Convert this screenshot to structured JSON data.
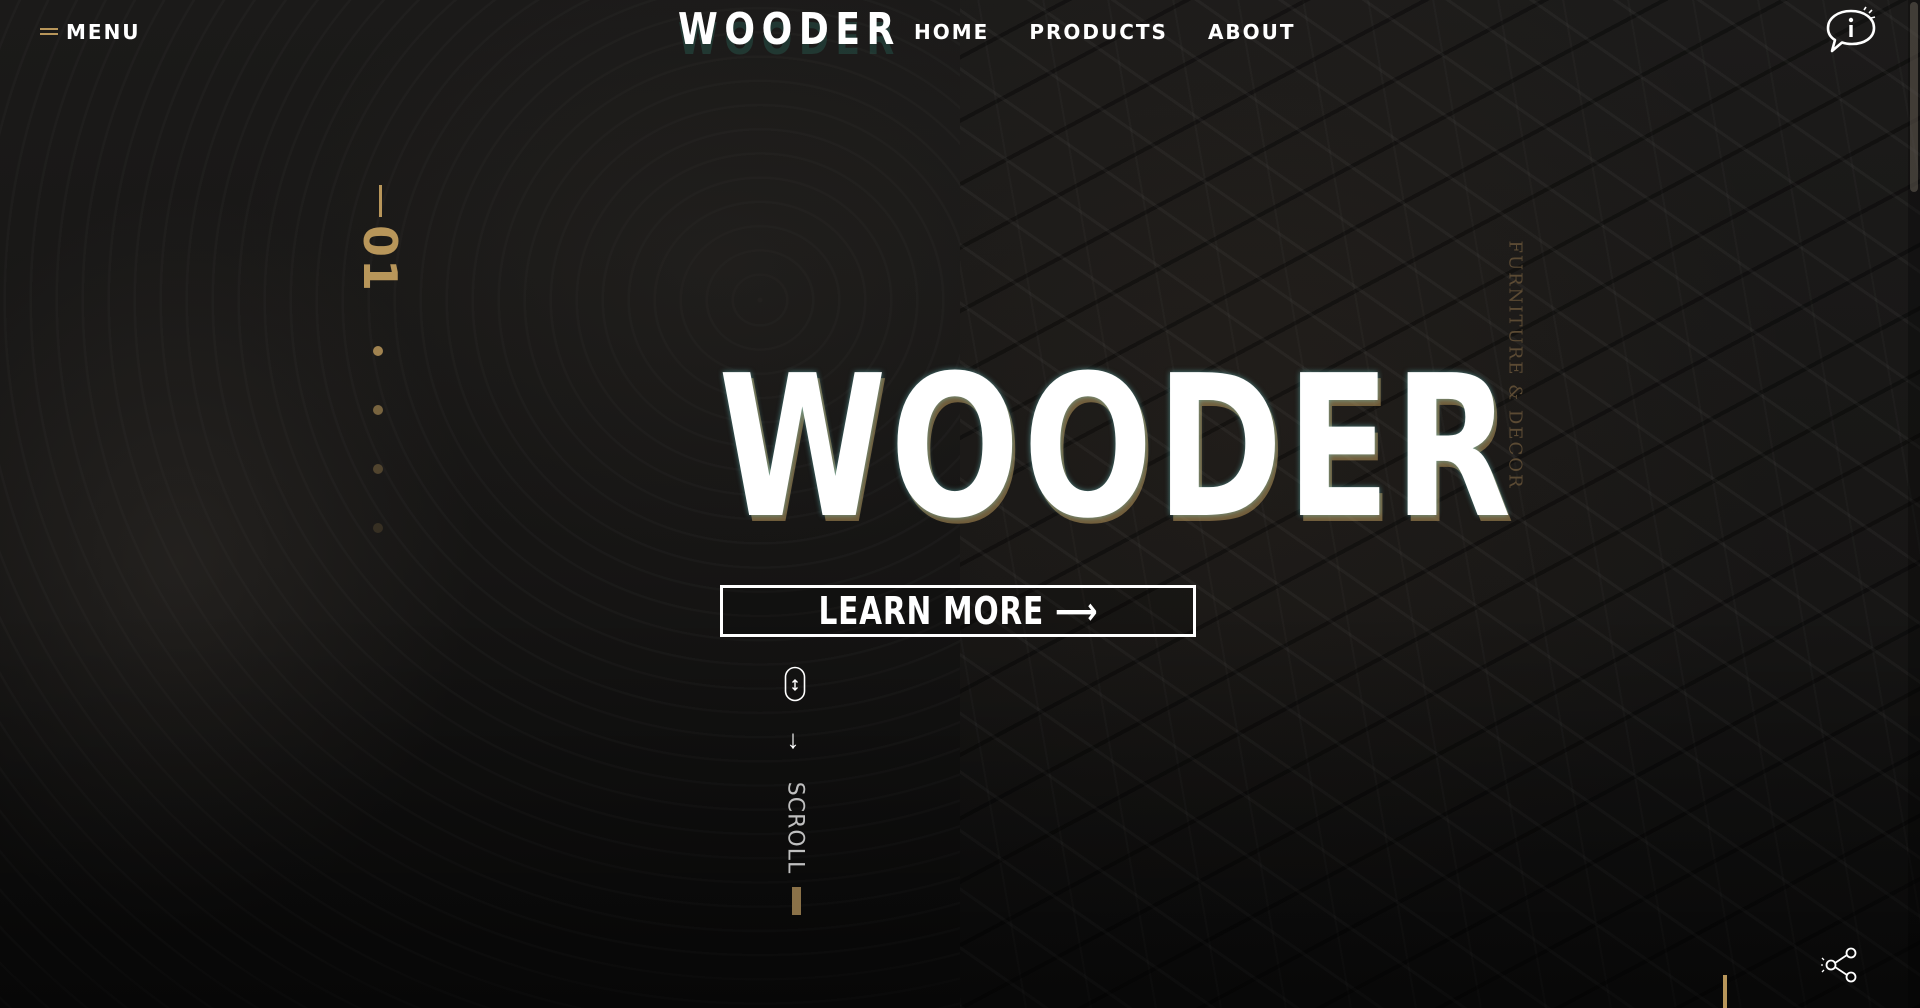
{
  "header": {
    "menu_label": "MENU",
    "logo": "WOODER",
    "nav": [
      {
        "label": "HOME"
      },
      {
        "label": "PRODUCTS"
      },
      {
        "label": "ABOUT"
      }
    ]
  },
  "slider": {
    "current": "01",
    "total_slides": 4,
    "active_index": 0
  },
  "hero": {
    "title": "WOODER",
    "cta_label": "LEARN MORE ⟶"
  },
  "side_text": "FURNITURE & DECOR",
  "scroll": {
    "label": "SCROLL",
    "arrow": "↓"
  },
  "colors": {
    "accent": "#b8965a",
    "text": "#ffffff",
    "background": "#121212"
  },
  "icons": {
    "menu": "hamburger-icon",
    "chat": "speech-bubble-info-icon",
    "share": "share-icon",
    "mouse": "mouse-scroll-icon"
  }
}
